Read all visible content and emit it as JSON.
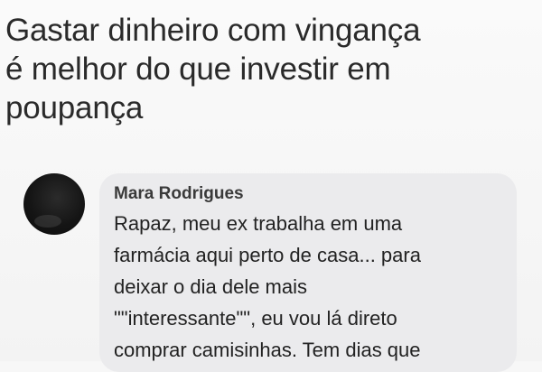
{
  "post": {
    "headline": "Gastar dinheiro com vingança\né melhor do que investir em\npoupança"
  },
  "comment": {
    "author": "Mara Rodrigues",
    "avatar": "profile-photo",
    "text": "Rapaz, meu ex trabalha em uma\nfarmácia aqui perto de casa... para\ndeixar o dia dele mais\n\"\"interessante\"\", eu vou lá direto\ncomprar camisinhas. Tem dias que"
  },
  "colors": {
    "background": "#f5f5f5",
    "bubble": "#ebebed",
    "text": "#222222"
  }
}
